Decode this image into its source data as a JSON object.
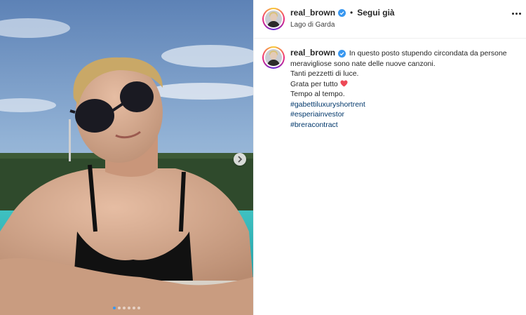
{
  "post": {
    "username": "real_brown",
    "separator": "•",
    "follow_label": "Segui già",
    "location": "Lago di Garda",
    "more_icon": "more-horizontal-icon",
    "verified_icon": "verified-badge-icon",
    "verified_color": "#3897f0"
  },
  "caption": {
    "username": "real_brown",
    "line1": "In questo posto stupendo circondata da persone meravigliose sono nate delle nuove canzoni.",
    "line2": "Tanti pezzetti di luce.",
    "line3": "Grata per tutto",
    "line3_emoji": "red-heart-icon",
    "line4": "Tempo al tempo.",
    "hashtags": [
      "#gabettiluxuryshortrent",
      "#esperiainvestor",
      "#breracontract"
    ]
  },
  "media": {
    "next_icon": "chevron-right-icon",
    "carousel_count": 6,
    "carousel_active": 1
  },
  "colors": {
    "hashtag": "#00376b",
    "active_dot": "#3897f0",
    "heart": "#ed4956"
  }
}
